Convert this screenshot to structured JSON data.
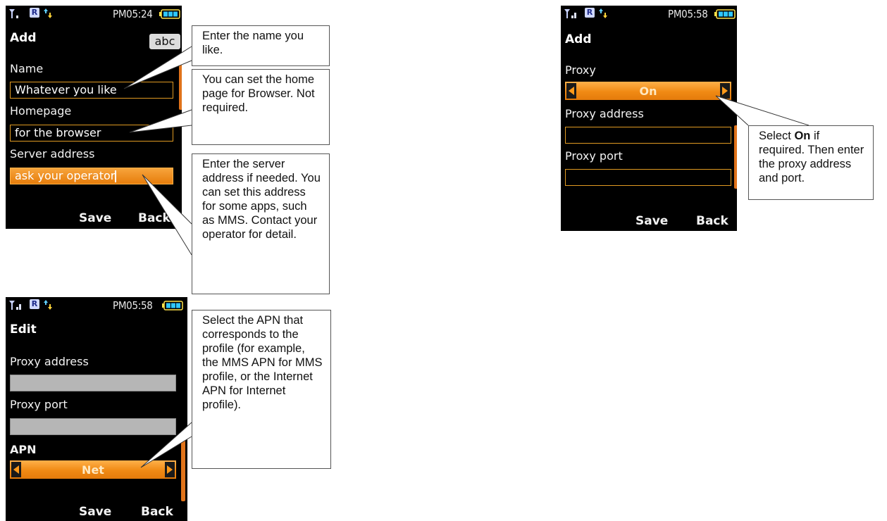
{
  "status": {
    "time_add": "PM05:24",
    "time_other": "PM05:58",
    "roaming": "R"
  },
  "screen_add": {
    "title": "Add",
    "input_mode": "abc",
    "fields": [
      {
        "label": "Name",
        "value": "Whatever you like"
      },
      {
        "label": "Homepage",
        "value": "for the browser"
      },
      {
        "label": "Server address",
        "value": "ask your operator"
      }
    ],
    "softkeys": {
      "save": "Save",
      "back": "Back"
    }
  },
  "screen_edit": {
    "title": "Edit",
    "proxy_address_label": "Proxy address",
    "proxy_port_label": "Proxy port",
    "apn_label": "APN",
    "apn_value": "Net",
    "softkeys": {
      "save": "Save",
      "back": "Back"
    }
  },
  "screen_proxy": {
    "title": "Add",
    "proxy_label": "Proxy",
    "proxy_value": "On",
    "proxy_address_label": "Proxy address",
    "proxy_port_label": "Proxy port",
    "softkeys": {
      "save": "Save",
      "back": "Back"
    }
  },
  "callouts": {
    "name": "Enter the name you like.",
    "homepage": "You can set the home page for Browser. Not required.",
    "server": "Enter the server address if needed. You can set this address for some apps, such as MMS. Contact your operator for detail.",
    "apn": "Select the APN that corresponds to the profile (for example, the MMS APN for MMS profile, or the Internet APN for Internet profile).",
    "proxy_prefix": "Select",
    "proxy_bold": "On",
    "proxy_suffix": "if required. Then enter the proxy address and port."
  },
  "colors": {
    "accent_orange": "#f08a14",
    "field_border": "#e09a22",
    "scrollbar": "#e0731a",
    "screen_bg": "#000000"
  },
  "icons": [
    "signal-icon",
    "roaming-icon",
    "data-transfer-icon",
    "battery-icon",
    "left-arrow-icon",
    "right-arrow-icon"
  ]
}
